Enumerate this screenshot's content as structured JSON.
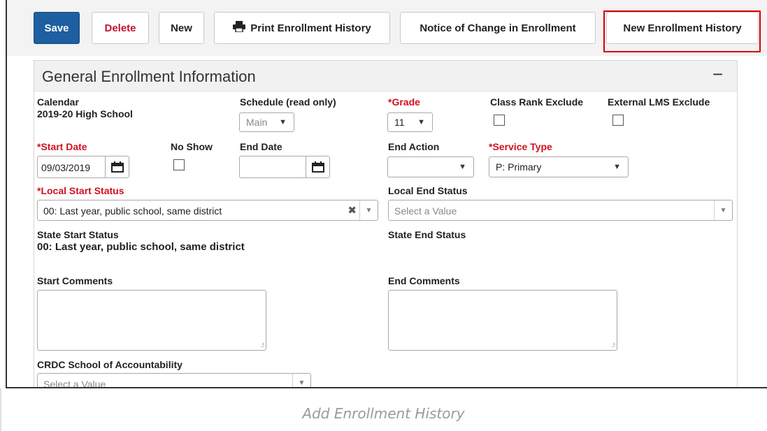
{
  "toolbar": {
    "save": "Save",
    "delete": "Delete",
    "new": "New",
    "print_history": "Print Enrollment History",
    "notice_change": "Notice of Change in Enrollment",
    "new_history": "New Enrollment History"
  },
  "panel": {
    "title": "General Enrollment Information",
    "collapse": "−"
  },
  "form": {
    "calendar_label": "Calendar",
    "calendar_value": "2019-20 High School",
    "schedule_label": "Schedule (read only)",
    "schedule_value": "Main",
    "grade_label": "*Grade",
    "grade_value": "11",
    "class_rank_label": "Class Rank Exclude",
    "external_lms_label": "External LMS Exclude",
    "start_date_label": "*Start Date",
    "start_date_value": "09/03/2019",
    "no_show_label": "No Show",
    "end_date_label": "End Date",
    "end_date_value": "",
    "end_action_label": "End Action",
    "end_action_value": "",
    "service_type_label": "*Service Type",
    "service_type_value": "P: Primary",
    "local_start_status_label": "*Local Start Status",
    "local_start_status_value": "00: Last year, public school, same district",
    "local_end_status_label": "Local End Status",
    "local_end_status_placeholder": "Select a Value",
    "state_start_status_label": "State Start Status",
    "state_start_status_value": "00: Last year, public school, same district",
    "state_end_status_label": "State End Status",
    "start_comments_label": "Start Comments",
    "end_comments_label": "End Comments",
    "crdc_label": "CRDC School of Accountability",
    "crdc_placeholder": "Select a Value"
  },
  "caption": "Add Enrollment History"
}
